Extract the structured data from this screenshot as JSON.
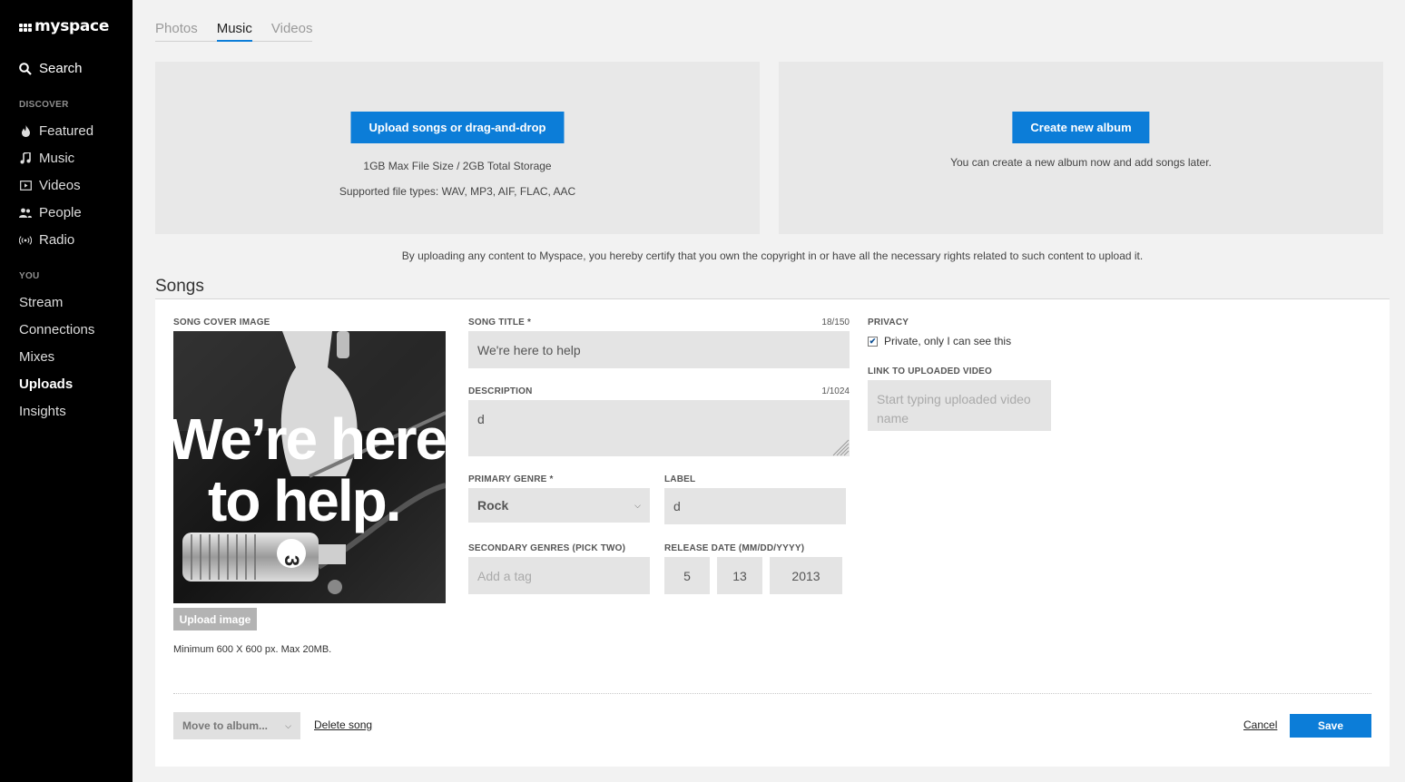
{
  "sidebar": {
    "logo_text": "myspace",
    "search_label": "Search",
    "discover_heading": "DISCOVER",
    "discover_items": [
      {
        "label": "Featured",
        "icon": "flame-icon"
      },
      {
        "label": "Music",
        "icon": "music-note-icon"
      },
      {
        "label": "Videos",
        "icon": "video-icon"
      },
      {
        "label": "People",
        "icon": "people-icon"
      },
      {
        "label": "Radio",
        "icon": "radio-icon"
      }
    ],
    "you_heading": "YOU",
    "you_items": [
      "Stream",
      "Connections",
      "Mixes",
      "Uploads",
      "Insights"
    ],
    "active_item": "Uploads"
  },
  "tabs": {
    "items": [
      "Photos",
      "Music",
      "Videos"
    ],
    "active": "Music"
  },
  "upload_panel": {
    "button_label": "Upload songs or drag-and-drop",
    "size_note": "1GB Max File Size / 2GB Total Storage",
    "types_note": "Supported file types: WAV, MP3, AIF, FLAC, AAC"
  },
  "album_panel": {
    "button_label": "Create new album",
    "note": "You can create a new album now and add songs later."
  },
  "disclaimer": "By uploading any content to Myspace, you hereby certify that you own the copyright in or have all the necessary rights related to such content to upload it.",
  "songs_title": "Songs",
  "song": {
    "cover_label": "SONG COVER IMAGE",
    "cover_text_line1": "We’re here",
    "cover_text_line2": "to help.",
    "upload_image_label": "Upload image",
    "cover_note": "Minimum 600 X 600 px. Max 20MB.",
    "title_label": "SONG TITLE *",
    "title_count": "18/150",
    "title_value": "We're here to help",
    "description_label": "DESCRIPTION",
    "description_count": "1/1024",
    "description_value": "d",
    "genre_label": "PRIMARY GENRE *",
    "genre_value": "Rock",
    "label_label": "LABEL",
    "label_value": "d",
    "secondary_label": "SECONDARY GENRES (PICK TWO)",
    "secondary_placeholder": "Add a tag",
    "release_label": "RELEASE DATE (MM/DD/YYYY)",
    "release_month": "5",
    "release_day": "13",
    "release_year": "2013",
    "privacy_label": "PRIVACY",
    "privacy_checked": true,
    "privacy_text": "Private, only I can see this",
    "video_label": "LINK TO UPLOADED VIDEO",
    "video_placeholder": "Start typing uploaded video name"
  },
  "footer": {
    "move_label": "Move to album...",
    "delete_label": "Delete song",
    "cancel_label": "Cancel",
    "save_label": "Save"
  },
  "colors": {
    "accent": "#0c7dd8",
    "sidebar_bg": "#000000",
    "page_bg": "#f2f2f2"
  }
}
